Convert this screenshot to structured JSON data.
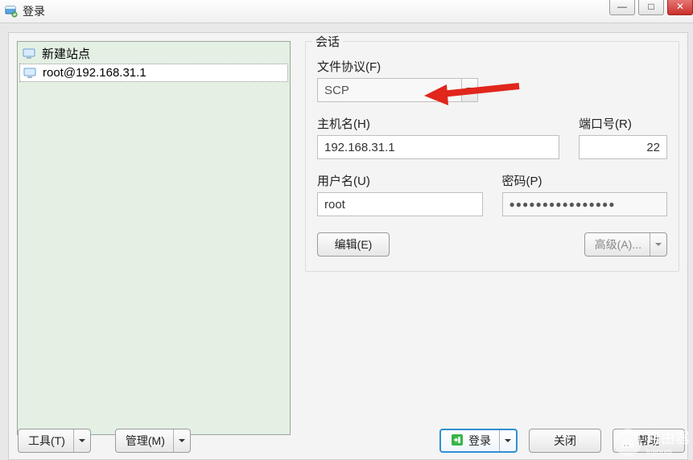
{
  "window": {
    "title": "登录",
    "controls": {
      "min": "—",
      "max": "□",
      "close": "✕"
    }
  },
  "sidebar": {
    "items": [
      {
        "label": "新建站点",
        "icon": "monitor-icon"
      },
      {
        "label": "root@192.168.31.1",
        "icon": "monitor-icon"
      }
    ]
  },
  "session": {
    "group_label": "会话",
    "protocol_label": "文件协议(F)",
    "protocol_value": "SCP",
    "host_label": "主机名(H)",
    "host_value": "192.168.31.1",
    "port_label": "端口号(R)",
    "port_value": "22",
    "user_label": "用户名(U)",
    "user_value": "root",
    "pass_label": "密码(P)",
    "pass_value": "●●●●●●●●●●●●●●●●",
    "edit_button": "编辑(E)",
    "advanced_button": "高级(A)..."
  },
  "footer": {
    "tools": "工具(T)",
    "manage": "管理(M)",
    "login": "登录",
    "close": "关闭",
    "help": "帮助"
  },
  "watermark": {
    "text": "路由器",
    "sub": "luyouqi"
  }
}
